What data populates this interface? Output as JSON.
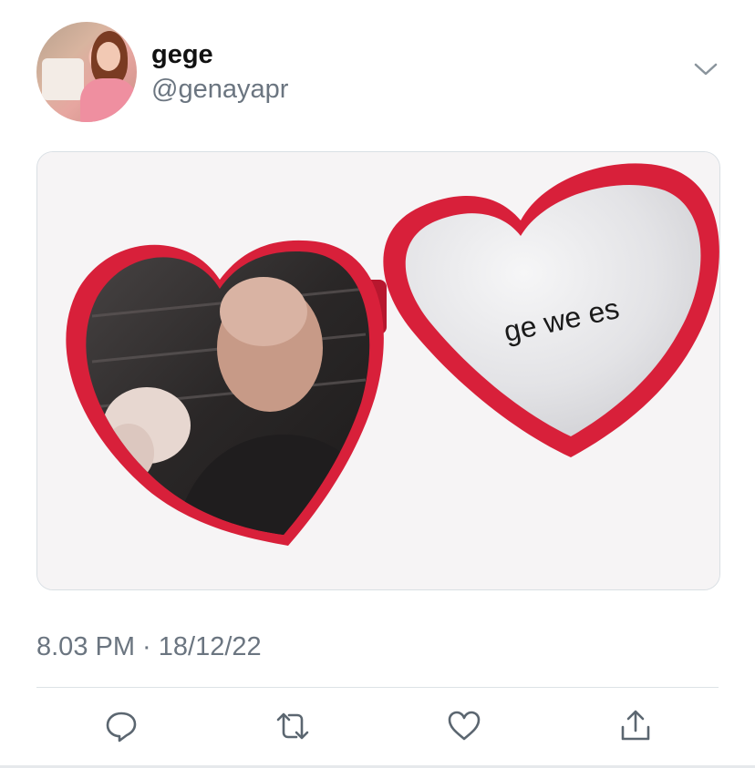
{
  "tweet": {
    "display_name": "gege",
    "handle": "@genayapr",
    "timestamp": "8.03 PM · 18/12/22",
    "image_caption": "ge we es"
  },
  "icons": {
    "more": "chevron-down-icon",
    "reply": "reply-icon",
    "retweet": "retweet-icon",
    "like": "heart-icon",
    "share": "share-icon"
  },
  "colors": {
    "text_primary": "#111111",
    "text_secondary": "#6b7580",
    "icon": "#5b6670",
    "locket_red": "#d8203a"
  }
}
